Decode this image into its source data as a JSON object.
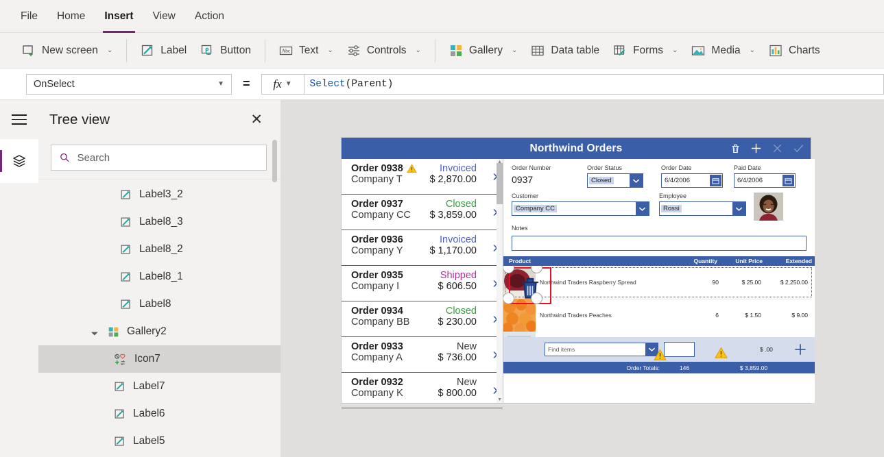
{
  "menubar": {
    "items": [
      {
        "label": "File",
        "active": false
      },
      {
        "label": "Home",
        "active": false
      },
      {
        "label": "Insert",
        "active": true
      },
      {
        "label": "View",
        "active": false
      },
      {
        "label": "Action",
        "active": false
      }
    ]
  },
  "ribbon": {
    "items": [
      {
        "label": "New screen",
        "icon": "new-screen-icon",
        "caret": "⌄"
      },
      {
        "label": "Label",
        "icon": "label-icon",
        "caret": ""
      },
      {
        "label": "Button",
        "icon": "button-icon",
        "caret": ""
      },
      {
        "label": "Text",
        "icon": "text-icon",
        "caret": "⌄"
      },
      {
        "label": "Controls",
        "icon": "controls-icon",
        "caret": "⌄"
      },
      {
        "label": "Gallery",
        "icon": "gallery-icon",
        "caret": "⌄"
      },
      {
        "label": "Data table",
        "icon": "data-table-icon",
        "caret": ""
      },
      {
        "label": "Forms",
        "icon": "forms-icon",
        "caret": "⌄"
      },
      {
        "label": "Media",
        "icon": "media-icon",
        "caret": "⌄"
      },
      {
        "label": "Charts",
        "icon": "charts-icon",
        "caret": ""
      }
    ]
  },
  "formula_bar": {
    "property": "OnSelect",
    "equals": "=",
    "fx_label": "fx",
    "formula_fn": "Select",
    "formula_args": "(Parent)"
  },
  "tree_view": {
    "title": "Tree view",
    "close_label": "✕",
    "search_placeholder": "Search",
    "search_value": "",
    "nodes": [
      {
        "label": "Label3_2",
        "icon": "label-icon",
        "indent": 2,
        "selected": false,
        "expander": ""
      },
      {
        "label": "Label8_3",
        "icon": "label-icon",
        "indent": 2,
        "selected": false,
        "expander": ""
      },
      {
        "label": "Label8_2",
        "icon": "label-icon",
        "indent": 2,
        "selected": false,
        "expander": ""
      },
      {
        "label": "Label8_1",
        "icon": "label-icon",
        "indent": 2,
        "selected": false,
        "expander": ""
      },
      {
        "label": "Label8",
        "icon": "label-icon",
        "indent": 2,
        "selected": false,
        "expander": ""
      },
      {
        "label": "Gallery2",
        "icon": "gallery-icon",
        "indent": 1,
        "selected": false,
        "expander": "◢"
      },
      {
        "label": "Icon7",
        "icon": "icon-icon",
        "indent": 3,
        "selected": true,
        "expander": ""
      },
      {
        "label": "Label7",
        "icon": "label-icon",
        "indent": 3,
        "selected": false,
        "expander": ""
      },
      {
        "label": "Label6",
        "icon": "label-icon",
        "indent": 3,
        "selected": false,
        "expander": ""
      },
      {
        "label": "Label5",
        "icon": "label-icon",
        "indent": 3,
        "selected": false,
        "expander": ""
      }
    ]
  },
  "app": {
    "title": "Northwind Orders",
    "header_actions": [
      {
        "name": "delete-order-icon",
        "glyph": "trash",
        "enabled": true
      },
      {
        "name": "new-order-icon",
        "glyph": "plus",
        "enabled": true
      },
      {
        "name": "cancel-icon",
        "glyph": "cross",
        "enabled": false
      },
      {
        "name": "confirm-icon",
        "glyph": "check",
        "enabled": true
      }
    ],
    "gallery": [
      {
        "order": "Order 0938",
        "company": "Company T",
        "status": "Invoiced",
        "status_color": "#4f5fc4",
        "amount": "$ 2,870.00",
        "warning": true
      },
      {
        "order": "Order 0937",
        "company": "Company CC",
        "status": "Closed",
        "status_color": "#37a03b",
        "amount": "$ 3,859.00",
        "warning": false
      },
      {
        "order": "Order 0936",
        "company": "Company Y",
        "status": "Invoiced",
        "status_color": "#4f5fc4",
        "amount": "$ 1,170.00",
        "warning": false
      },
      {
        "order": "Order 0935",
        "company": "Company I",
        "status": "Shipped",
        "status_color": "#b4319b",
        "amount": "$ 606.50",
        "warning": false
      },
      {
        "order": "Order 0934",
        "company": "Company BB",
        "status": "Closed",
        "status_color": "#37a03b",
        "amount": "$ 230.00",
        "warning": false
      },
      {
        "order": "Order 0933",
        "company": "Company A",
        "status": "New",
        "status_color": "#3b3a39",
        "amount": "$ 736.00",
        "warning": false
      },
      {
        "order": "Order 0932",
        "company": "Company K",
        "status": "New",
        "status_color": "#3b3a39",
        "amount": "$ 800.00",
        "warning": false
      }
    ],
    "form": {
      "order_number_label": "Order Number",
      "order_number_value": "0937",
      "order_status_label": "Order Status",
      "order_status_value": "Closed",
      "order_date_label": "Order Date",
      "order_date_value": "6/4/2006",
      "paid_date_label": "Paid Date",
      "paid_date_value": "6/4/2006",
      "customer_label": "Customer",
      "customer_value": "Company CC",
      "employee_label": "Employee",
      "employee_value": "Rossi",
      "notes_label": "Notes",
      "notes_value": ""
    },
    "products": {
      "headers": [
        "Product",
        "Quantity",
        "Unit Price",
        "Extended"
      ],
      "rows": [
        {
          "name": "Northwind Traders Raspberry Spread",
          "qty": "90",
          "price": "$ 25.00",
          "ext": "$ 2,250.00",
          "selected": true
        },
        {
          "name": "Northwind Traders Peaches",
          "qty": "6",
          "price": "$ 1.50",
          "ext": "$ 9.00",
          "selected": false
        }
      ]
    },
    "add_row": {
      "find_placeholder": "Find items",
      "qty_value": "",
      "amount": "$ .00",
      "add_icon": "plus-icon"
    },
    "totals": {
      "label": "Order Totals:",
      "quantity": "146",
      "amount": "$ 3,859.00"
    }
  },
  "colors": {
    "accent_purple": "#742774",
    "app_blue": "#3b5ea8",
    "selection_red": "#e81123",
    "warning_yellow": "#ffc20e"
  }
}
